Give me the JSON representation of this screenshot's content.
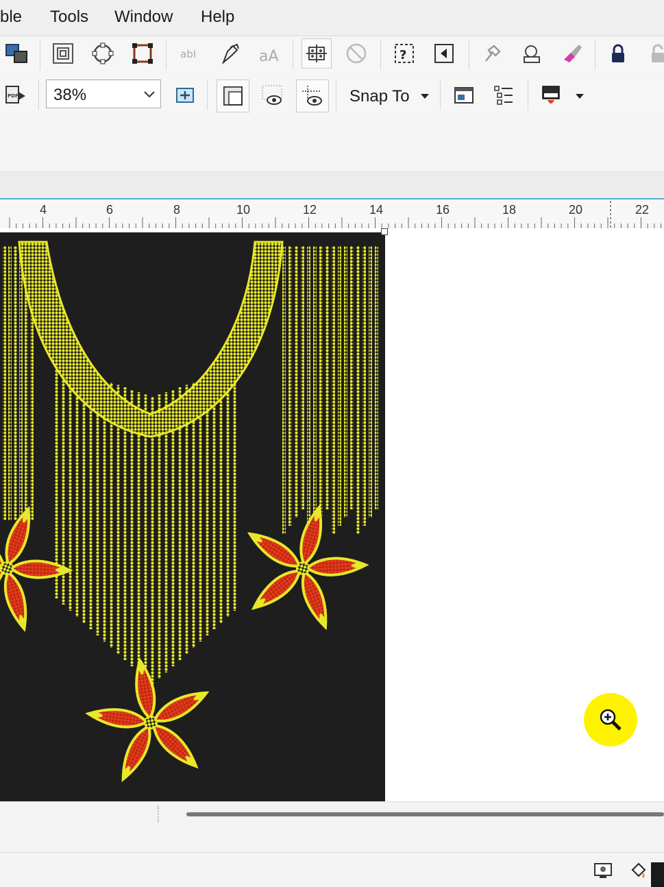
{
  "menubar": {
    "items": [
      {
        "label": "ble"
      },
      {
        "label": "Tools"
      },
      {
        "label": "Window"
      },
      {
        "label": "Help"
      }
    ]
  },
  "toolbar_standard": {
    "icons": [
      "arrange-icon",
      "frame-icon",
      "node-circle-icon",
      "transform-frame-icon",
      "text-icon",
      "pen-icon",
      "case-icon",
      "grid-icon",
      "no-entry-icon",
      "help-icon",
      "back-icon",
      "pin-icon",
      "camera-icon",
      "eraser-icon",
      "lock-icon",
      "unlock-icon"
    ]
  },
  "toolbar_property": {
    "zoom_value": "38%",
    "snap_label": "Snap To",
    "icons": [
      "pdf-export-icon",
      "zoom-fit-icon",
      "rulers-icon",
      "grid-view-icon",
      "guides-view-icon",
      "page-icon",
      "checklist-icon",
      "color-icon"
    ]
  },
  "ruler": {
    "labels": [
      "4",
      "6",
      "8",
      "10",
      "12",
      "14",
      "16",
      "18",
      "20",
      "22"
    ]
  },
  "colors": {
    "accent": "#4bb3cc",
    "canvas_bg": "#ffffff",
    "artwork_bg": "#1e1e1e",
    "bead_yellow": "#e8e82a",
    "petal_red": "#e43b1c",
    "cursor_yellow": "#fff200"
  },
  "canvas": {
    "cursor_icon": "zoom-in-cursor-icon"
  },
  "statusbar": {
    "icons": [
      "display-icon",
      "fill-bucket-icon"
    ]
  }
}
